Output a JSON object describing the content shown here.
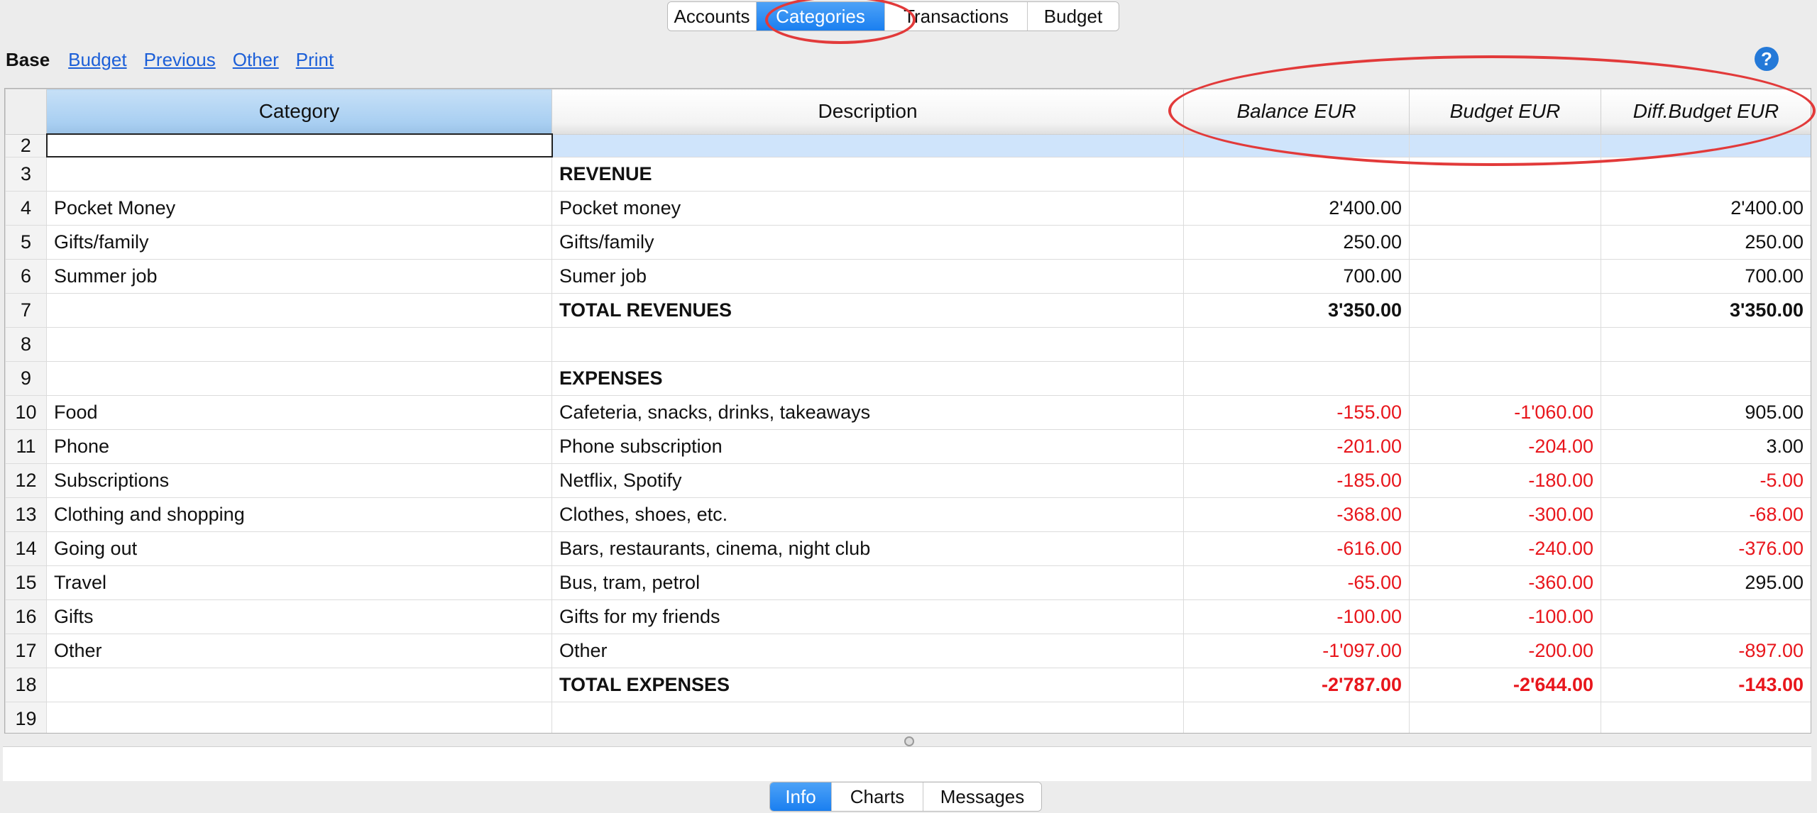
{
  "top_tabs": {
    "accounts": "Accounts",
    "categories": "Categories",
    "transactions": "Transactions",
    "budget": "Budget",
    "active": "Categories"
  },
  "views": {
    "base": "Base",
    "budget": "Budget",
    "previous": "Previous",
    "other": "Other",
    "print": "Print"
  },
  "help_icon": {
    "name": "help-icon",
    "glyph": "?"
  },
  "table": {
    "headers": {
      "category": "Category",
      "description": "Description",
      "balance": "Balance EUR",
      "budget": "Budget EUR",
      "diff_budget": "Diff.Budget EUR"
    },
    "rows": [
      {
        "n": "2",
        "category": "",
        "description": "",
        "balance": "",
        "budget": "",
        "diff": ""
      },
      {
        "n": "3",
        "category": "",
        "description": "REVENUE",
        "balance": "",
        "budget": "",
        "diff": ""
      },
      {
        "n": "4",
        "category": "Pocket Money",
        "description": "Pocket money",
        "balance": "2'400.00",
        "budget": "",
        "diff": "2'400.00"
      },
      {
        "n": "5",
        "category": "Gifts/family",
        "description": "Gifts/family",
        "balance": "250.00",
        "budget": "",
        "diff": "250.00"
      },
      {
        "n": "6",
        "category": "Summer job",
        "description": "Sumer job",
        "balance": "700.00",
        "budget": "",
        "diff": "700.00"
      },
      {
        "n": "7",
        "category": "",
        "description": "TOTAL REVENUES",
        "balance": "3'350.00",
        "budget": "",
        "diff": "3'350.00"
      },
      {
        "n": "8",
        "category": "",
        "description": "",
        "balance": "",
        "budget": "",
        "diff": ""
      },
      {
        "n": "9",
        "category": "",
        "description": "EXPENSES",
        "balance": "",
        "budget": "",
        "diff": ""
      },
      {
        "n": "10",
        "category": "Food",
        "description": "Cafeteria, snacks, drinks, takeaways",
        "balance": "-155.00",
        "budget": "-1'060.00",
        "diff": "905.00"
      },
      {
        "n": "11",
        "category": "Phone",
        "description": "Phone subscription",
        "balance": "-201.00",
        "budget": "-204.00",
        "diff": "3.00"
      },
      {
        "n": "12",
        "category": "Subscriptions",
        "description": "Netflix, Spotify",
        "balance": "-185.00",
        "budget": "-180.00",
        "diff": "-5.00"
      },
      {
        "n": "13",
        "category": "Clothing and shopping",
        "description": "Clothes, shoes, etc.",
        "balance": "-368.00",
        "budget": "-300.00",
        "diff": "-68.00"
      },
      {
        "n": "14",
        "category": "Going out",
        "description": "Bars, restaurants, cinema, night club",
        "balance": "-616.00",
        "budget": "-240.00",
        "diff": "-376.00"
      },
      {
        "n": "15",
        "category": "Travel",
        "description": "Bus, tram, petrol",
        "balance": "-65.00",
        "budget": "-360.00",
        "diff": "295.00"
      },
      {
        "n": "16",
        "category": "Gifts",
        "description": "Gifts for my friends",
        "balance": "-100.00",
        "budget": "-100.00",
        "diff": ""
      },
      {
        "n": "17",
        "category": "Other",
        "description": "Other",
        "balance": "-1'097.00",
        "budget": "-200.00",
        "diff": "-897.00"
      },
      {
        "n": "18",
        "category": "",
        "description": "TOTAL EXPENSES",
        "balance": "-2'787.00",
        "budget": "-2'644.00",
        "diff": "-143.00"
      },
      {
        "n": "19",
        "category": "",
        "description": "",
        "balance": "",
        "budget": "",
        "diff": ""
      }
    ]
  },
  "bottom_tabs": {
    "info": "Info",
    "charts": "Charts",
    "messages": "Messages",
    "active": "Info"
  },
  "colors": {
    "accent": "#1a7ff0",
    "negative": "#e8161c",
    "annotation": "#e23a3a",
    "selected_row": "#cfe4fb"
  }
}
